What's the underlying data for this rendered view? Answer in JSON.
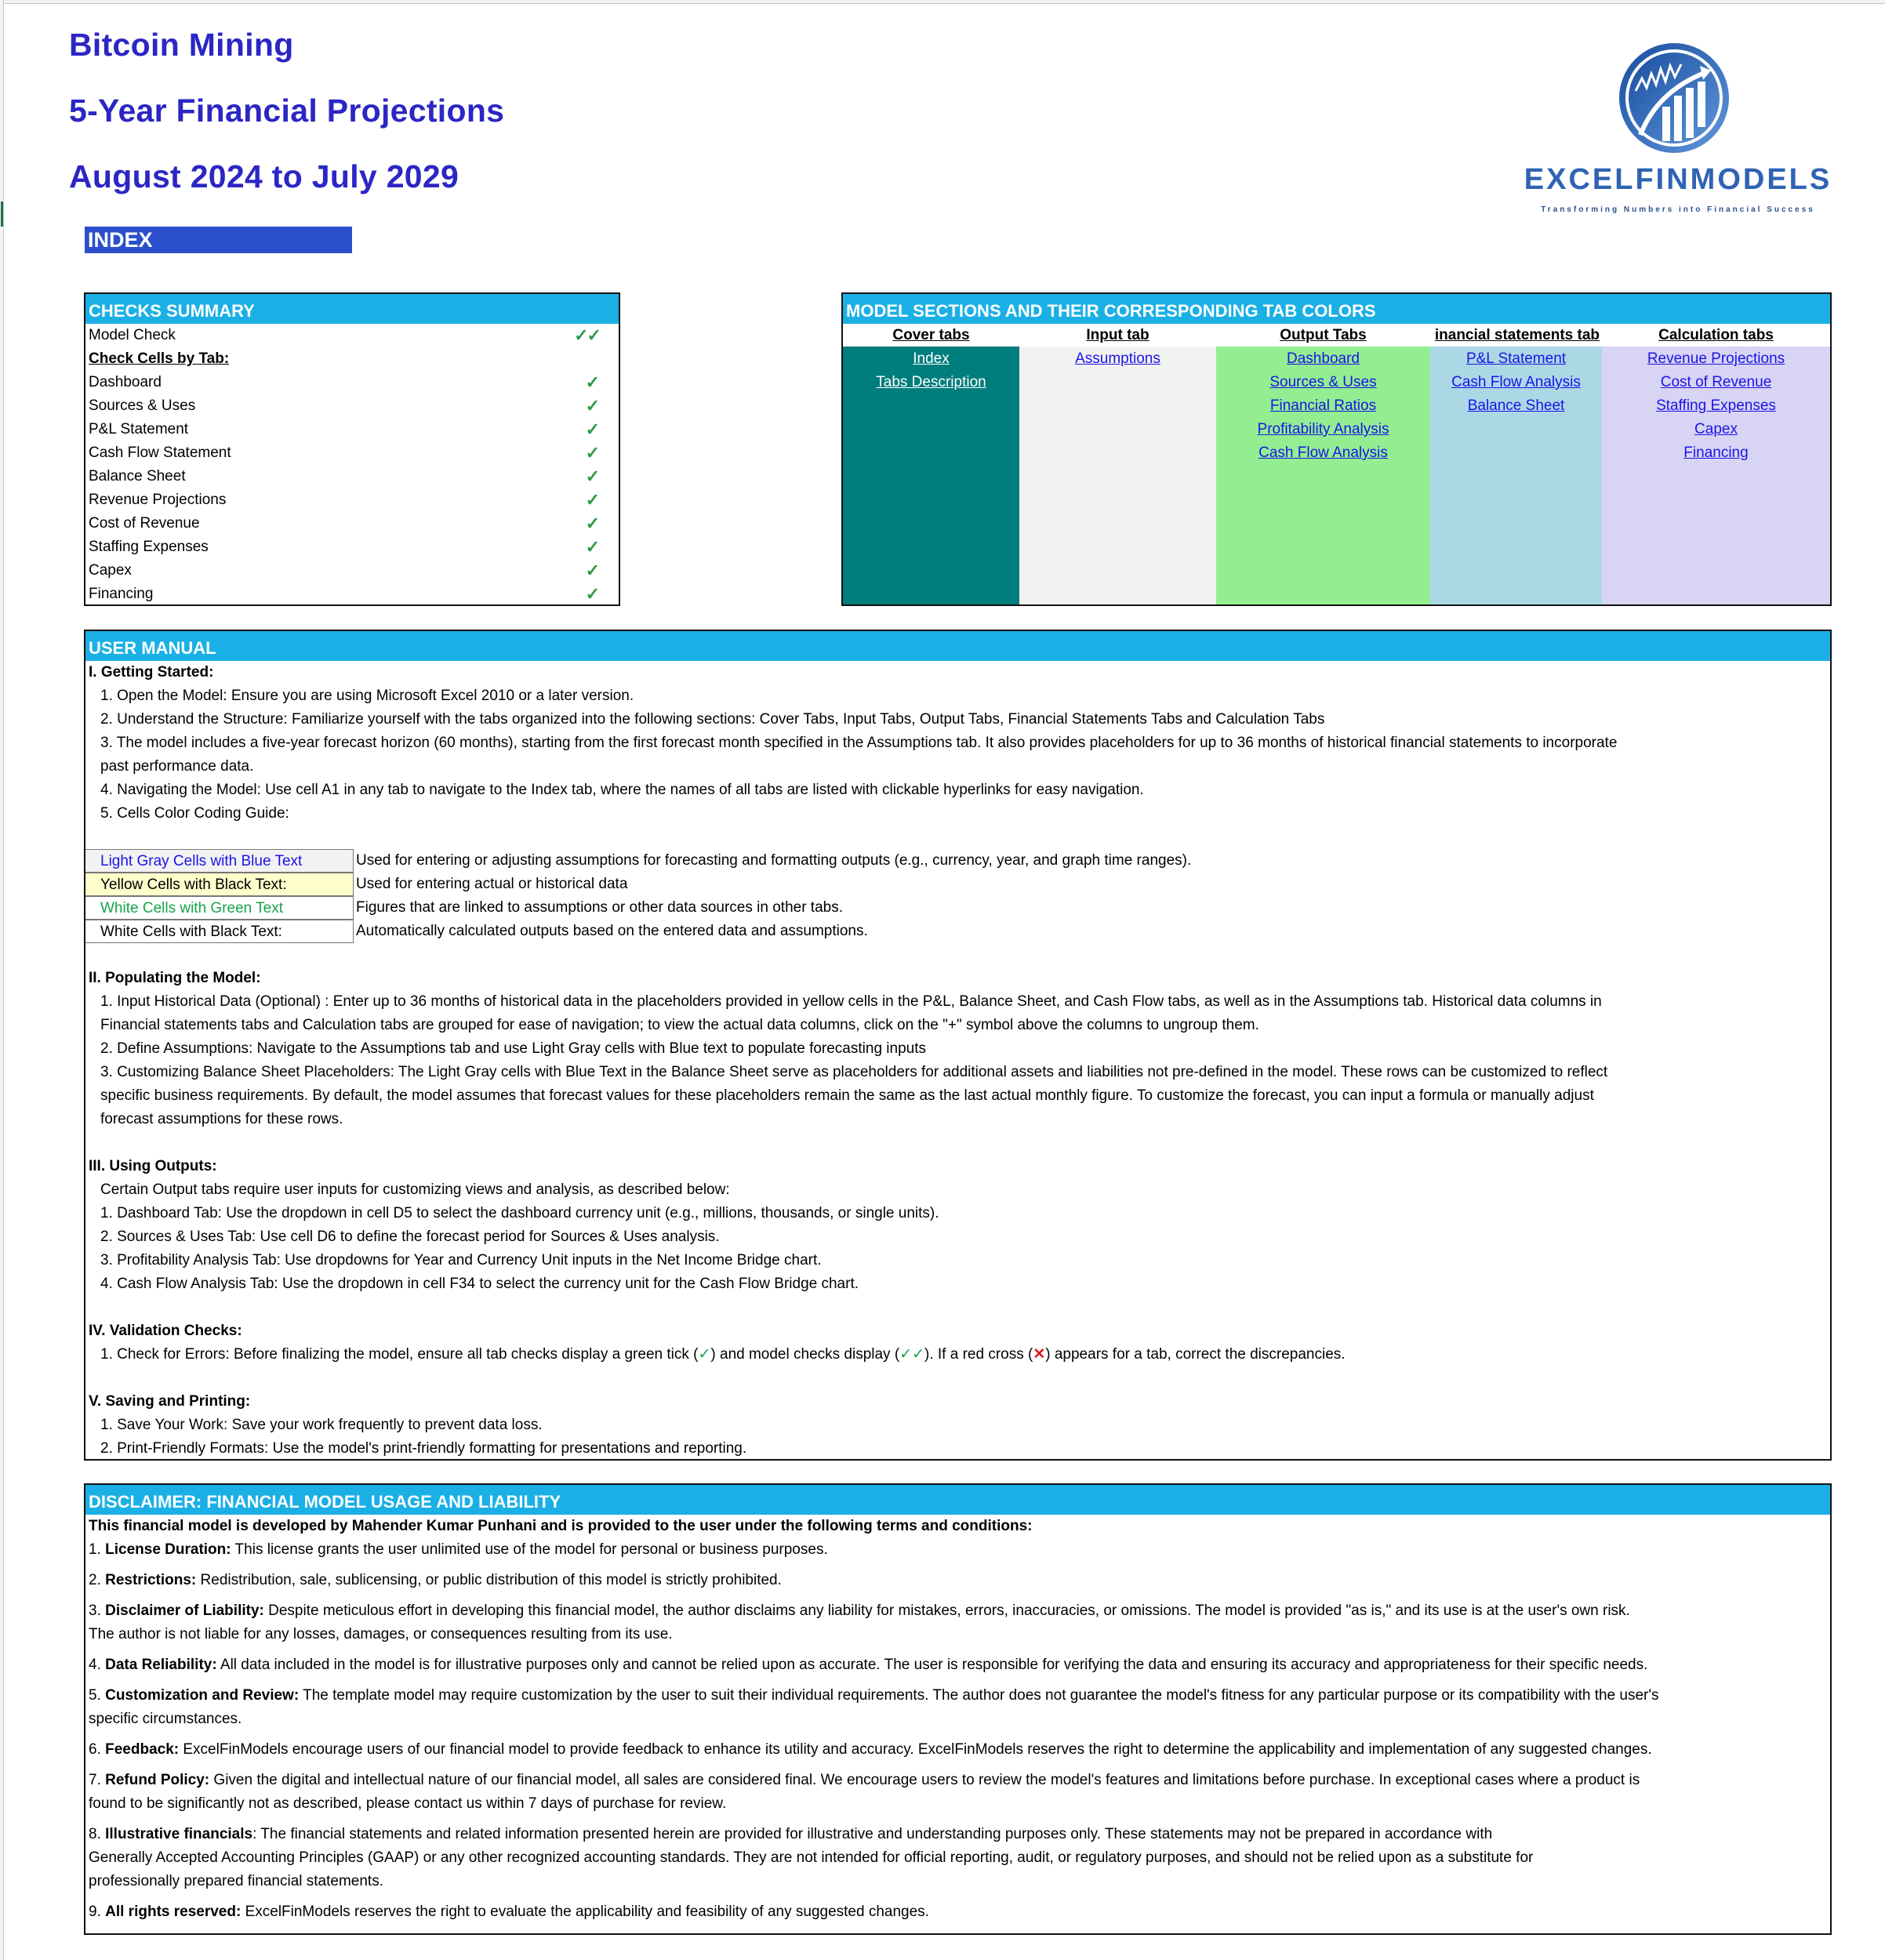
{
  "header": {
    "title_line1": "Bitcoin Mining",
    "title_line2": "5-Year Financial Projections",
    "title_line3": "August 2024 to July 2029",
    "index_label": "INDEX",
    "title_color": "#2b26c4"
  },
  "logo": {
    "icon": "chart-growth-icon",
    "wordmark": "EXCELFINMODELS",
    "tagline": "Transforming Numbers into Financial Success"
  },
  "checks_summary": {
    "title": "CHECKS  SUMMARY",
    "model_check_label": "Model Check",
    "model_check_status": "✓✓",
    "subheading": "Check Cells by Tab:",
    "items": [
      {
        "label": "Dashboard",
        "status": "✓"
      },
      {
        "label": "Sources & Uses",
        "status": "✓"
      },
      {
        "label": "P&L Statement",
        "status": "✓"
      },
      {
        "label": "Cash Flow Statement",
        "status": "✓"
      },
      {
        "label": "Balance Sheet",
        "status": "✓"
      },
      {
        "label": "Revenue Projections",
        "status": "✓"
      },
      {
        "label": "Cost of Revenue",
        "status": "✓"
      },
      {
        "label": "Staffing Expenses",
        "status": "✓"
      },
      {
        "label": "Capex",
        "status": "✓"
      },
      {
        "label": "Financing",
        "status": "✓"
      }
    ]
  },
  "model_sections": {
    "title": "MODEL SECTIONS AND THEIR CORRESPONDING TAB COLORS",
    "columns": [
      {
        "heading": "Cover tabs",
        "color": "#007d7d",
        "links": [
          "Index",
          "Tabs Description"
        ]
      },
      {
        "heading": "Input tab",
        "color": "#f2f2f2",
        "links": [
          "Assumptions "
        ]
      },
      {
        "heading": "Output Tabs",
        "color": "#92ee91",
        "links": [
          "Dashboard",
          "Sources & Uses",
          "Financial Ratios ",
          "Profitability Analysis",
          "Cash Flow Analysis"
        ]
      },
      {
        "heading": "inancial statements tab",
        "color": "#acd8e5",
        "links": [
          "P&L Statement",
          "Cash Flow Analysis",
          "Balance Sheet"
        ]
      },
      {
        "heading": "Calculation tabs",
        "color": "#d8d4f4",
        "links": [
          "Revenue Projections",
          "Cost of Revenue",
          "Staffing Expenses",
          "Capex ",
          "Financing"
        ]
      }
    ]
  },
  "user_manual": {
    "title": "USER MANUAL",
    "s1": {
      "heading": "I. Getting Started:",
      "lines": [
        "1. Open the Model: Ensure you are using Microsoft Excel 2010 or a later version.",
        "2. Understand the Structure: Familiarize yourself with the tabs organized into the following sections: Cover Tabs, Input Tabs, Output Tabs, Financial Statements Tabs and  Calculation Tabs",
        "3. The model includes a five-year forecast horizon (60 months), starting from the first forecast month specified in the Assumptions tab. It also provides placeholders for up to 36 months of historical financial statements to incorporate",
        "past performance data.",
        "4. Navigating the Model: Use cell A1 in any tab to navigate to the Index tab, where the names of all tabs are listed with clickable hyperlinks for easy navigation.",
        "5. Cells Color Coding Guide:"
      ]
    },
    "color_guide": [
      {
        "cell": "Light Gray Cells with Blue Text",
        "desc": "Used for entering or adjusting assumptions for forecasting and formatting outputs (e.g., currency, year, and graph time ranges)."
      },
      {
        "cell": "Yellow Cells with Black Text:",
        "desc": "Used for entering actual or historical data"
      },
      {
        "cell": "White Cells with Green Text",
        "desc": "Figures that are linked to assumptions or other data sources in other tabs."
      },
      {
        "cell": "White Cells with Black Text:",
        "desc": "Automatically calculated outputs based on the entered data and assumptions."
      }
    ],
    "s2": {
      "heading": "II. Populating the Model:",
      "lines": [
        "1. Input Historical Data (Optional) : Enter up to 36 months of historical data in the placeholders provided in yellow cells in the P&L, Balance Sheet, and Cash Flow tabs, as well as in the Assumptions tab. Historical data columns in",
        "Financial statements tabs and Calculation tabs are grouped for ease of navigation; to view the actual data columns, click on the \"+\" symbol above the columns to ungroup them.",
        "2. Define Assumptions: Navigate to the Assumptions tab and use Light Gray cells with Blue text to populate forecasting inputs",
        "3. Customizing Balance Sheet Placeholders: The Light Gray cells with Blue Text in the Balance Sheet serve as placeholders for additional assets and liabilities not pre-defined in the model. These rows can be customized to reflect",
        "specific business requirements. By default, the model assumes that forecast values for these placeholders remain the same as the last actual monthly figure. To customize the forecast, you can input a formula or manually adjust",
        "forecast assumptions for these rows."
      ]
    },
    "s3": {
      "heading": "III. Using Outputs:",
      "lines": [
        "Certain Output tabs require user inputs for customizing views and analysis, as described below:",
        "1. Dashboard Tab: Use the dropdown in cell D5 to select the dashboard currency unit (e.g., millions, thousands, or single units).",
        "2. Sources & Uses Tab: Use cell D6 to define the forecast period for Sources & Uses analysis.",
        "3. Profitability Analysis Tab: Use dropdowns for Year and Currency Unit inputs in the Net Income Bridge chart.",
        "4. Cash Flow Analysis Tab: Use the dropdown in cell F34 to select the currency unit for the Cash Flow Bridge chart."
      ]
    },
    "s4": {
      "heading": "IV. Validation Checks:",
      "line_part1": "1. Check for Errors:  Before finalizing the model, ensure all tab checks display a green tick (",
      "tick": "✓",
      "line_part2": ") and model checks display  (",
      "double_tick": "✓✓",
      "line_part3": "). If a red cross (",
      "cross": "✕",
      "line_part4": ") appears for a tab, correct the discrepancies."
    },
    "s5": {
      "heading": "V. Saving and Printing:",
      "lines": [
        "1. Save Your Work: Save your work frequently to prevent data loss.",
        "2. Print-Friendly Formats: Use the model's print-friendly formatting for presentations and reporting."
      ]
    }
  },
  "disclaimer": {
    "title": "DISCLAIMER: FINANCIAL MODEL USAGE AND LIABILITY",
    "intro": "This financial model  is developed by Mahender Kumar Punhani and is provided to the user under the following terms and conditions:",
    "items": [
      {
        "num": "1. ",
        "label": "License Duration:",
        "lines": [
          " This license grants the user unlimited use of the model for personal or business purposes."
        ]
      },
      {
        "num": "2. ",
        "label": "Restrictions:",
        "lines": [
          " Redistribution, sale, sublicensing, or public distribution of this model is strictly prohibited."
        ]
      },
      {
        "num": "3. ",
        "label": "Disclaimer of Liability:",
        "lines": [
          " Despite meticulous effort in developing this financial model, the author disclaims any liability for mistakes, errors, inaccuracies, or omissions. The model is provided \"as is,\" and its use is at the user's own risk.",
          "The author is not liable for  any losses, damages, or consequences resulting from its use."
        ]
      },
      {
        "num": "4. ",
        "label": "Data Reliability:",
        "lines": [
          " All data included in the model is for illustrative purposes only and cannot be relied upon as accurate. The user is  responsible for verifying the data and ensuring its accuracy and appropriateness for their specific needs."
        ]
      },
      {
        "num": "5. ",
        "label": "Customization and Review:",
        "lines": [
          " The template model may require customization by the user to suit their individual requirements. The author does not guarantee the model's fitness for any  particular purpose or its compatibility with the user's",
          "specific circumstances."
        ]
      },
      {
        "num": "6. ",
        "label": "Feedback:",
        "lines": [
          " ExcelFinModels encourage users of our financial model to provide feedback to enhance its utility and accuracy. ExcelFinModels reserves the right to determine the applicability and implementation of any suggested changes."
        ]
      },
      {
        "num": "7. ",
        "label": "Refund Policy:",
        "lines": [
          " Given the digital and intellectual nature of our financial model, all sales are considered final. We encourage users to review the model's features and limitations before purchase. In exceptional cases where a product is",
          "found to be  significantly not as described, please contact us within 7 days of purchase for review."
        ]
      },
      {
        "num": "8. ",
        "label": "Illustrative financials",
        "lines": [
          ": The financial statements and related information presented herein are provided for illustrative and understanding purposes only. These statements may not be prepared in accordance with",
          "Generally Accepted Accounting Principles (GAAP)  or any other  recognized accounting standards. They are not intended for official reporting, audit, or regulatory purposes, and should not be relied upon as a substitute for",
          "professionally prepared financial statements."
        ]
      },
      {
        "num": "9. ",
        "label": "All rights reserved:",
        "lines": [
          " ExcelFinModels reserves the right to evaluate the applicability and feasibility of any suggested changes."
        ]
      }
    ]
  }
}
